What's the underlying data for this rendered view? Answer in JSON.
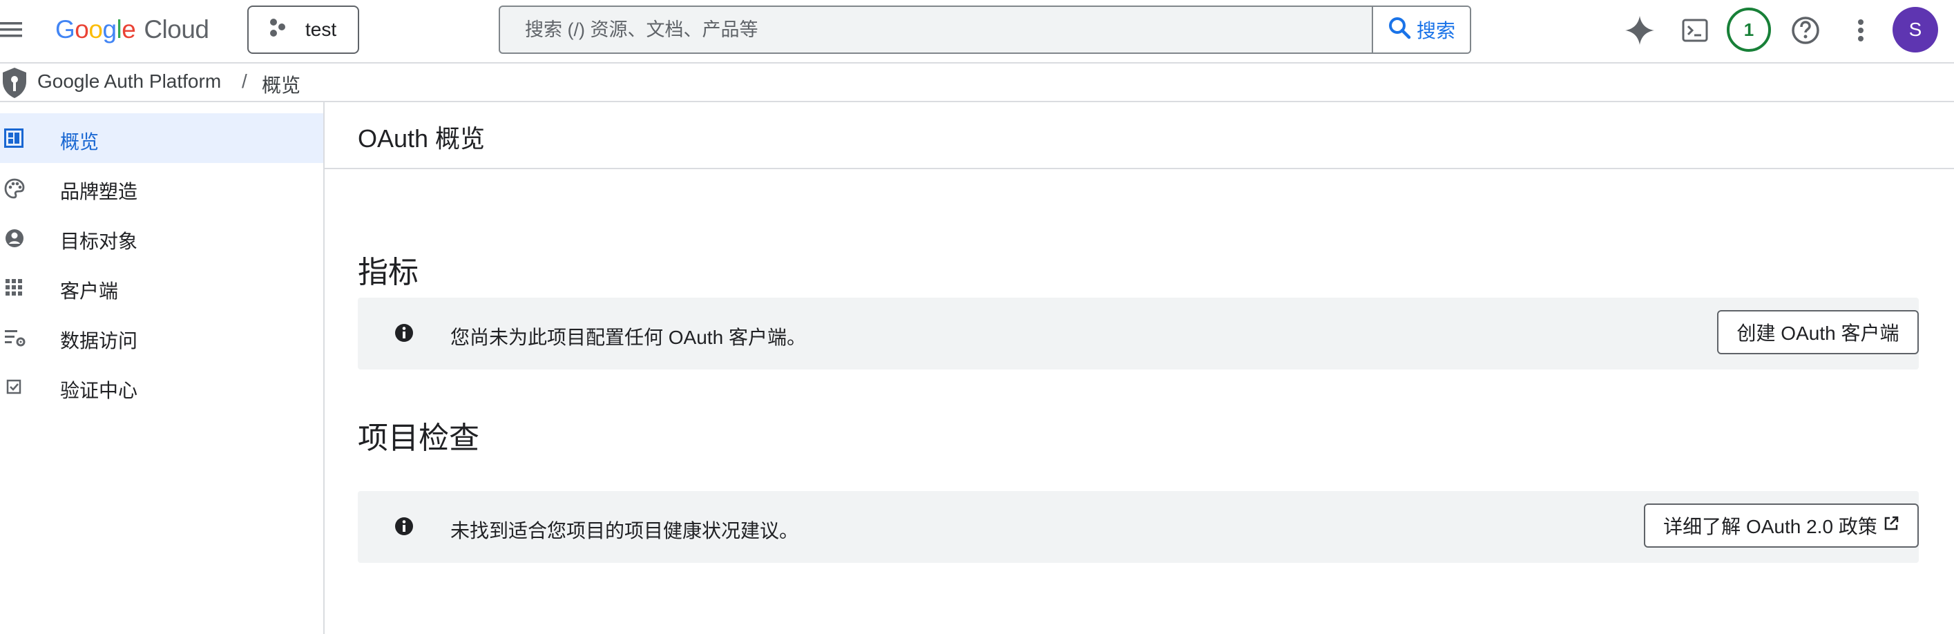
{
  "header": {
    "logo_google": "Google",
    "logo_cloud": "Cloud",
    "project_name": "test",
    "search_placeholder": "搜索 (/) 资源、文档、产品等",
    "search_button_label": "搜索",
    "notification_count": "1",
    "avatar_initial": "S"
  },
  "breadcrumb": {
    "product": "Google Auth Platform",
    "separator": "/",
    "page": "概览"
  },
  "sidebar": {
    "items": [
      {
        "label": "概览",
        "icon": "dashboard-icon",
        "active": true
      },
      {
        "label": "品牌塑造",
        "icon": "palette-icon",
        "active": false
      },
      {
        "label": "目标对象",
        "icon": "account-circle-icon",
        "active": false
      },
      {
        "label": "客户端",
        "icon": "apps-grid-icon",
        "active": false
      },
      {
        "label": "数据访问",
        "icon": "data-settings-icon",
        "active": false
      },
      {
        "label": "验证中心",
        "icon": "checkbox-icon",
        "active": false
      }
    ]
  },
  "main": {
    "page_title": "OAuth 概览",
    "metrics": {
      "heading": "指标",
      "message": "您尚未为此项目配置任何 OAuth 客户端。",
      "button_label": "创建 OAuth 客户端"
    },
    "project_checkup": {
      "heading": "项目检查",
      "message": "未找到适合您项目的项目健康状况建议。",
      "button_label": "详细了解 OAuth 2.0 政策"
    }
  },
  "colors": {
    "accent_blue": "#1a73e8",
    "active_nav_bg": "#e8f0fe",
    "notification_green": "#188038",
    "avatar_purple": "#5e35b1",
    "notice_bg": "#f1f3f4"
  }
}
